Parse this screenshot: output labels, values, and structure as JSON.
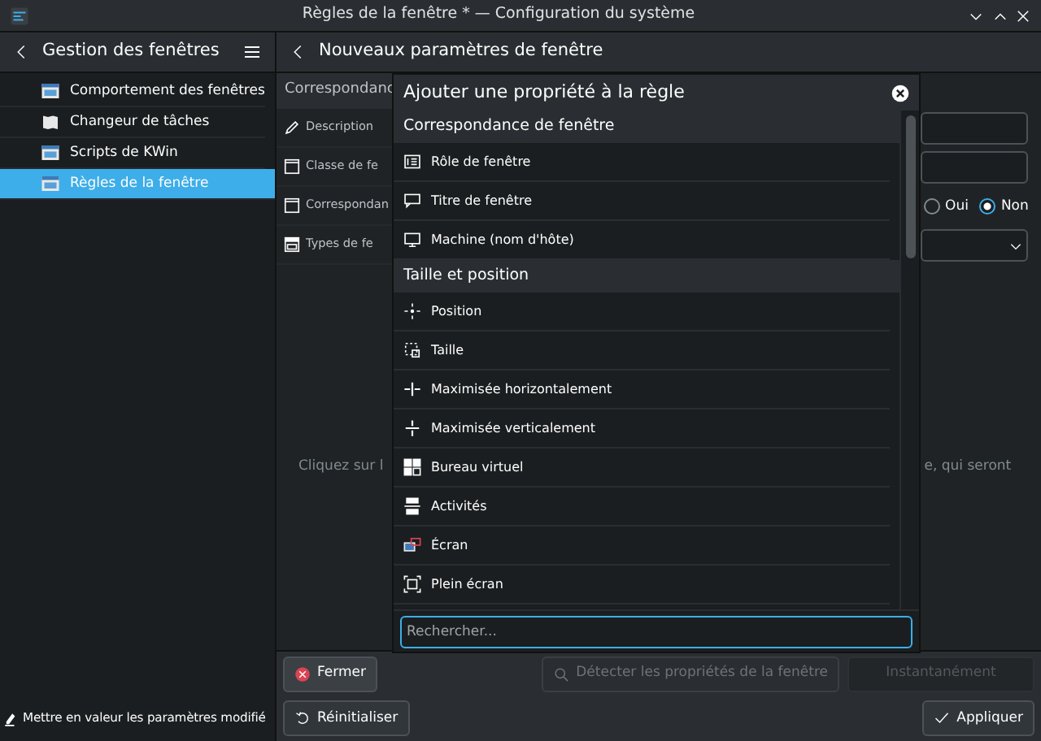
{
  "window": {
    "title": "Règles de la fenêtre * — Configuration du système"
  },
  "sidebar": {
    "title": "Gestion des fenêtres",
    "items": [
      {
        "label": "Comportement des fenêtres",
        "selected": false
      },
      {
        "label": "Changeur de tâches",
        "selected": false
      },
      {
        "label": "Scripts de KWin",
        "selected": false
      },
      {
        "label": "Règles de la fenêtre",
        "selected": true
      }
    ],
    "footer_button": "Mettre en valeur les paramètres modifié"
  },
  "page": {
    "title": "Nouveaux paramètres de fenêtre",
    "section": "Correspondanc",
    "rows": [
      {
        "kind": "text",
        "label": "Description"
      },
      {
        "kind": "text",
        "label": "Classe de fe"
      },
      {
        "kind": "radio",
        "label": "Correspondan",
        "options": [
          {
            "label": "Oui",
            "selected": false
          },
          {
            "label": "Non",
            "selected": true
          }
        ]
      },
      {
        "kind": "select",
        "label": "Types de fe"
      }
    ],
    "hint_left": "Cliquez sur l",
    "hint_right": "e, qui seront"
  },
  "dialog": {
    "title": "Ajouter une propriété à la règle",
    "groups": [
      {
        "heading": "Correspondance de fenêtre",
        "items": [
          "Rôle de fenêtre",
          "Titre de fenêtre",
          "Machine (nom d'hôte)"
        ]
      },
      {
        "heading": "Taille et position",
        "items": [
          "Position",
          "Taille",
          "Maximisée horizontalement",
          "Maximisée verticalement",
          "Bureau virtuel",
          "Activités",
          "Écran",
          "Plein écran"
        ]
      }
    ],
    "search": {
      "placeholder": "Rechercher..."
    }
  },
  "footer": {
    "close_button": "Fermer",
    "detect_button": {
      "label": "Détecter les propriétés de la fenêtre",
      "disabled": true
    },
    "delay": {
      "value": "Instantanément",
      "disabled": true
    },
    "reset_button": "Réinitialiser",
    "apply_button": "Appliquer"
  }
}
